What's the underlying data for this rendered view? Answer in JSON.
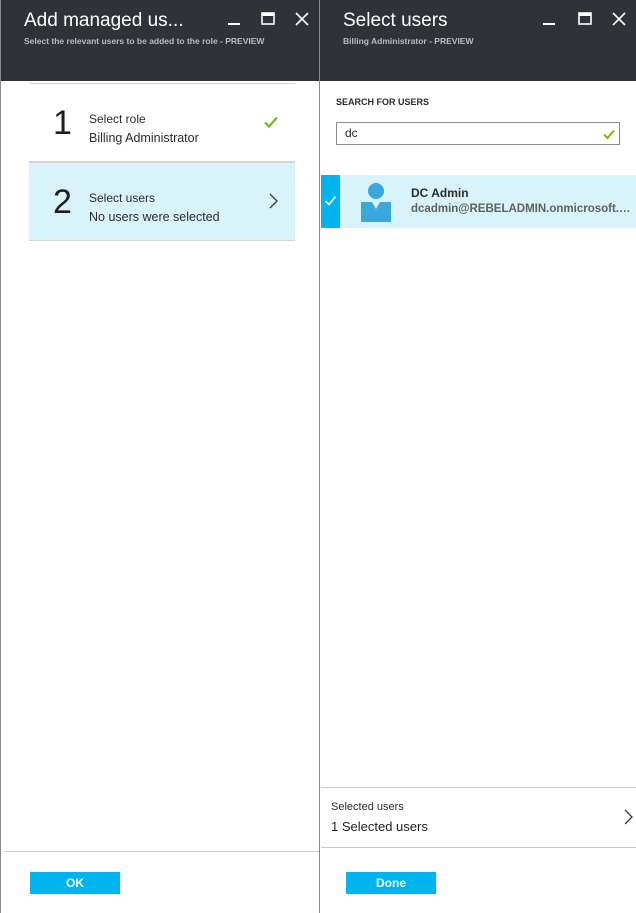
{
  "left_blade": {
    "title": "Add managed us...",
    "subtitle": "Select the relevant users to be added to the role - PREVIEW",
    "steps": [
      {
        "number": "1",
        "title": "Select role",
        "value": "Billing Administrator",
        "status_icon": "checkmark-icon"
      },
      {
        "number": "2",
        "title": "Select users",
        "value": "No users were selected",
        "status_icon": "chevron-right-icon"
      }
    ],
    "ok_label": "OK"
  },
  "right_blade": {
    "title": "Select users",
    "subtitle": "Billing Administrator - PREVIEW",
    "search": {
      "label": "SEARCH FOR USERS",
      "value": "dc"
    },
    "results": [
      {
        "name": "DC Admin",
        "email": "dcadmin@REBELADMIN.onmicrosoft.com",
        "selected": true
      }
    ],
    "selected_summary": {
      "label": "Selected users",
      "value": "1 Selected users"
    },
    "done_label": "Done"
  },
  "colors": {
    "header_bg": "#2f3338",
    "accent": "#00b4f0",
    "selected_row_bg": "#d9f3fb",
    "check_green": "#7fba00"
  },
  "header_controls": [
    "minimize-icon",
    "maximize-icon",
    "close-icon"
  ]
}
